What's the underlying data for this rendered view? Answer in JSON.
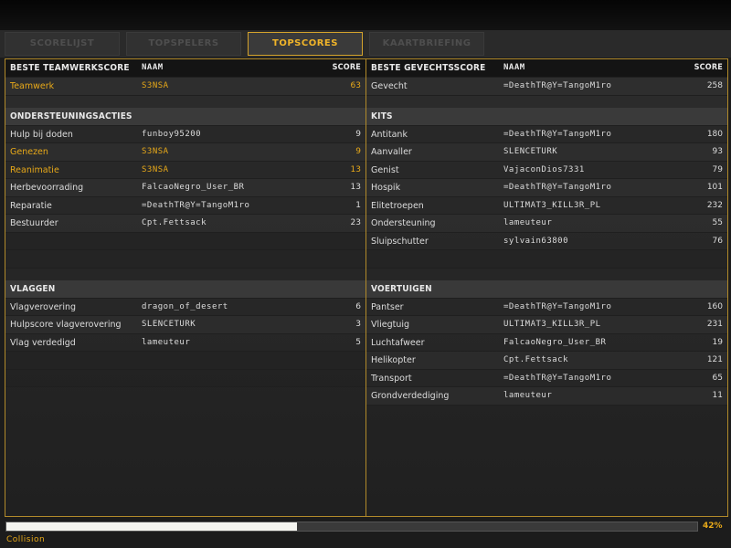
{
  "tabs": [
    {
      "label": "SCORELIJST",
      "active": false
    },
    {
      "label": "TOPSPELERS",
      "active": false
    },
    {
      "label": "TOPSCORES",
      "active": true
    },
    {
      "label": "KAARTBRIEFING",
      "active": false
    }
  ],
  "left": {
    "header": {
      "title": "BESTE TEAMWERKSCORE",
      "name": "NAAM",
      "score": "SCORE"
    },
    "top_row": {
      "label": "Teamwerk",
      "name": "S3NSA",
      "score": "63",
      "highlight": true
    },
    "support": {
      "title": "ONDERSTEUNINGSACTIES",
      "rows": [
        {
          "label": "Hulp bij doden",
          "name": "funboy95200",
          "score": "9",
          "highlight": false
        },
        {
          "label": "Genezen",
          "name": "S3NSA",
          "score": "9",
          "highlight": true
        },
        {
          "label": "Reanimatie",
          "name": "S3NSA",
          "score": "13",
          "highlight": true
        },
        {
          "label": "Herbevoorrading",
          "name": "FalcaoNegro_User_BR",
          "score": "13",
          "highlight": false
        },
        {
          "label": "Reparatie",
          "name": "=DeathTR@Y=TangoM1ro",
          "score": "1",
          "highlight": false
        },
        {
          "label": "Bestuurder",
          "name": "Cpt.Fettsack",
          "score": "23",
          "highlight": false
        }
      ]
    },
    "flags": {
      "title": "VLAGGEN",
      "rows": [
        {
          "label": "Vlagverovering",
          "name": "dragon_of_desert",
          "score": "6",
          "highlight": false
        },
        {
          "label": "Hulpscore vlagverovering",
          "name": "SLENCETURK",
          "score": "3",
          "highlight": false
        },
        {
          "label": "Vlag verdedigd",
          "name": "lameuteur",
          "score": "5",
          "highlight": false
        }
      ]
    }
  },
  "right": {
    "header": {
      "title": "BESTE GEVECHTSSCORE",
      "name": "NAAM",
      "score": "SCORE"
    },
    "top_row": {
      "label": "Gevecht",
      "name": "=DeathTR@Y=TangoM1ro",
      "score": "258",
      "highlight": false
    },
    "kits": {
      "title": "KITS",
      "rows": [
        {
          "label": "Antitank",
          "name": "=DeathTR@Y=TangoM1ro",
          "score": "180",
          "highlight": false
        },
        {
          "label": "Aanvaller",
          "name": "SLENCETURK",
          "score": "93",
          "highlight": false
        },
        {
          "label": "Genist",
          "name": "VajaconDios7331",
          "score": "79",
          "highlight": false
        },
        {
          "label": "Hospik",
          "name": "=DeathTR@Y=TangoM1ro",
          "score": "101",
          "highlight": false
        },
        {
          "label": "Elitetroepen",
          "name": "ULTIMAT3_KILL3R_PL",
          "score": "232",
          "highlight": false
        },
        {
          "label": "Ondersteuning",
          "name": "lameuteur",
          "score": "55",
          "highlight": false
        },
        {
          "label": "Sluipschutter",
          "name": "sylvain63800",
          "score": "76",
          "highlight": false
        }
      ]
    },
    "vehicles": {
      "title": "VOERTUIGEN",
      "rows": [
        {
          "label": "Pantser",
          "name": "=DeathTR@Y=TangoM1ro",
          "score": "160",
          "highlight": false
        },
        {
          "label": "Vliegtuig",
          "name": "ULTIMAT3_KILL3R_PL",
          "score": "231",
          "highlight": false
        },
        {
          "label": "Luchtafweer",
          "name": "FalcaoNegro_User_BR",
          "score": "19",
          "highlight": false
        },
        {
          "label": "Helikopter",
          "name": "Cpt.Fettsack",
          "score": "121",
          "highlight": false
        },
        {
          "label": "Transport",
          "name": "=DeathTR@Y=TangoM1ro",
          "score": "65",
          "highlight": false
        },
        {
          "label": "Grondverdediging",
          "name": "lameuteur",
          "score": "11",
          "highlight": false
        }
      ]
    }
  },
  "loading": {
    "progress": 0.42,
    "percent_text": "42%",
    "map_name": "Collision"
  },
  "colors": {
    "accent": "#e8a919",
    "border": "#b18a2a",
    "inactive_tab": "#4e4e4e"
  }
}
